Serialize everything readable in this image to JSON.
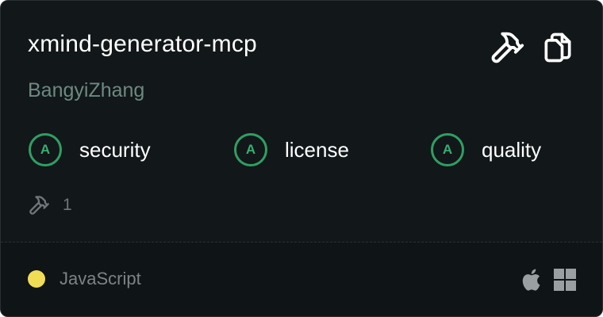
{
  "server": {
    "name": "xmind-generator-mcp",
    "author": "BangyiZhang"
  },
  "actions": {
    "tools_icon": "hammer-icon",
    "copy_icon": "copy-icon"
  },
  "scores": [
    {
      "grade": "A",
      "label": "security"
    },
    {
      "grade": "A",
      "label": "license"
    },
    {
      "grade": "A",
      "label": "quality"
    }
  ],
  "tools": {
    "icon": "hammer-icon",
    "count": "1"
  },
  "footer": {
    "language": "JavaScript",
    "language_color": "#f1dd55",
    "platforms": [
      "apple-icon",
      "windows-icon"
    ]
  },
  "colors": {
    "card_bg": "#121719",
    "grade_accent": "#2f9e63",
    "author_text": "#6c8a80"
  }
}
